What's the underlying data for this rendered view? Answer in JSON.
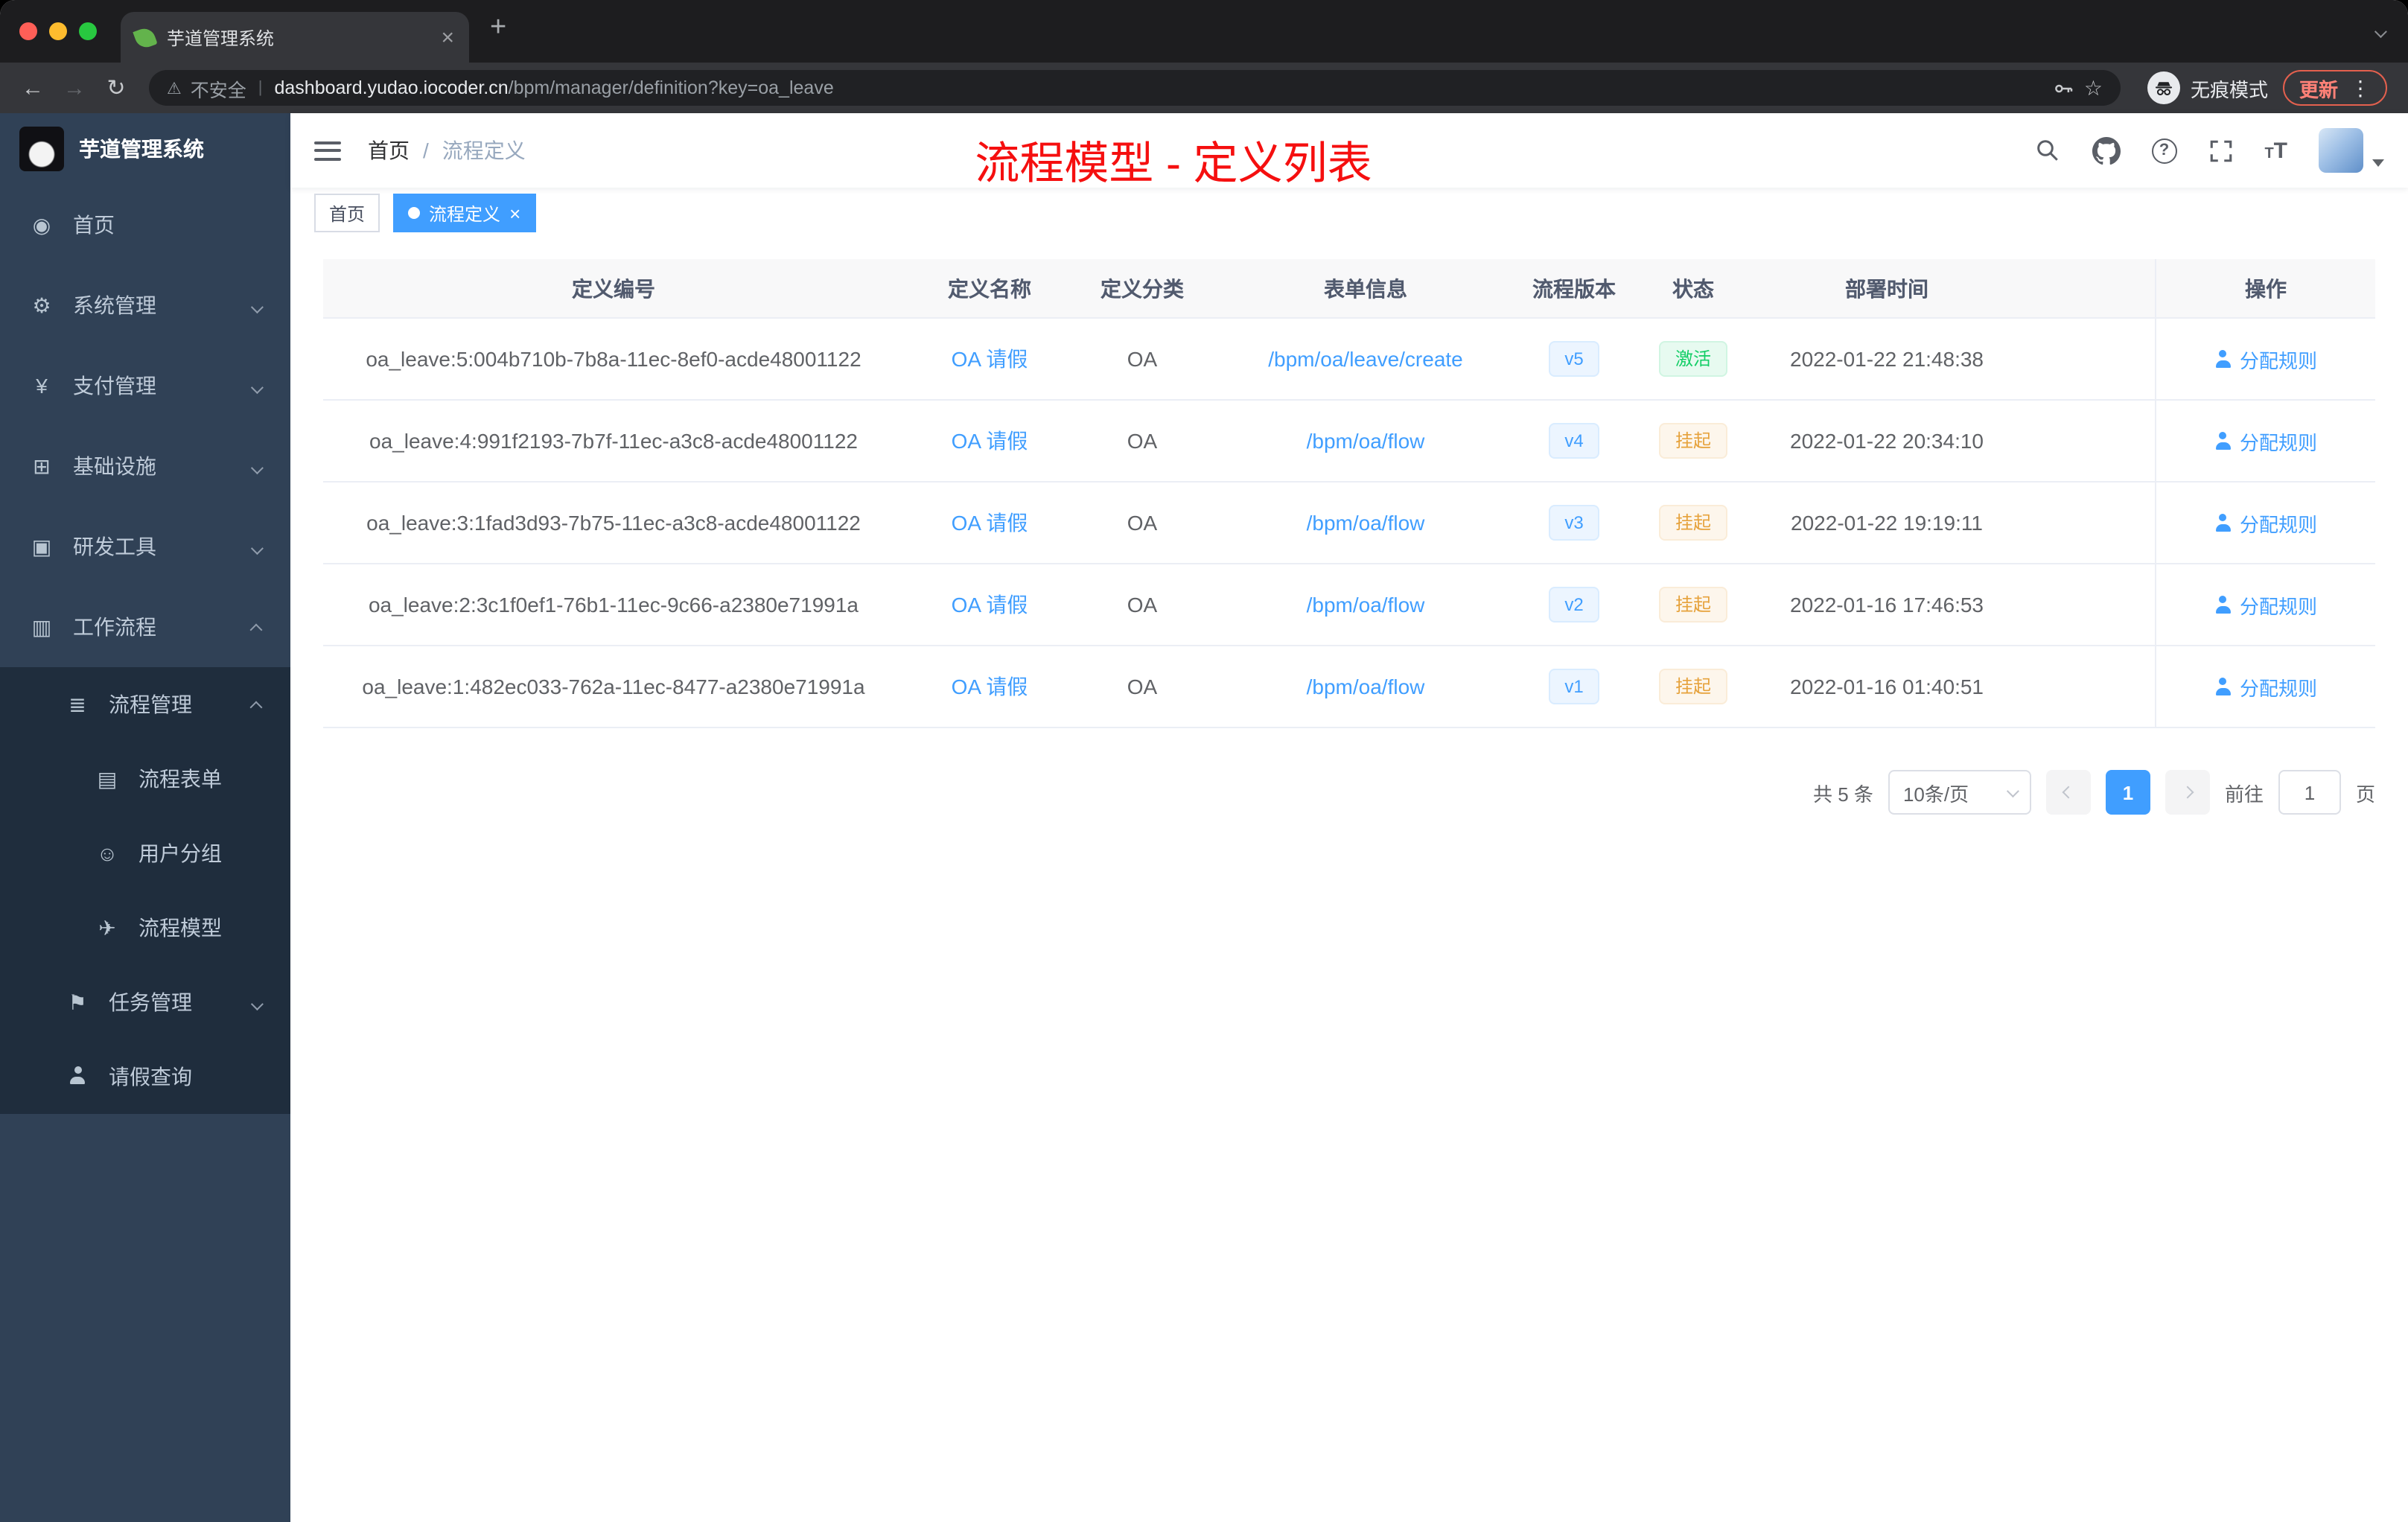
{
  "browser": {
    "tab_title": "芋道管理系统",
    "security_label": "不安全",
    "url_host": "dashboard.yudao.iocoder.cn",
    "url_path": "/bpm/manager/definition?key=oa_leave",
    "incognito_label": "无痕模式",
    "update_button": "更新"
  },
  "sidebar": {
    "logo_title": "芋道管理系统",
    "items": [
      {
        "label": "首页"
      },
      {
        "label": "系统管理"
      },
      {
        "label": "支付管理"
      },
      {
        "label": "基础设施"
      },
      {
        "label": "研发工具"
      },
      {
        "label": "工作流程"
      },
      {
        "label": "流程管理"
      },
      {
        "label": "流程表单"
      },
      {
        "label": "用户分组"
      },
      {
        "label": "流程模型"
      },
      {
        "label": "任务管理"
      },
      {
        "label": "请假查询"
      }
    ]
  },
  "navbar": {
    "breadcrumb_home": "首页",
    "breadcrumb_separator": "/",
    "breadcrumb_current": "流程定义",
    "annotation": "流程模型 - 定义列表"
  },
  "tags": {
    "home": "首页",
    "current": "流程定义"
  },
  "table": {
    "headers": [
      "定义编号",
      "定义名称",
      "定义分类",
      "表单信息",
      "流程版本",
      "状态",
      "部署时间",
      "操作"
    ],
    "rows": [
      {
        "id": "oa_leave:5:004b710b-7b8a-11ec-8ef0-acde48001122",
        "name": "OA 请假",
        "category": "OA",
        "form": "/bpm/oa/leave/create",
        "version": "v5",
        "status": "激活",
        "status_type": "success",
        "deploy_time": "2022-01-22 21:48:38",
        "action": "分配规则"
      },
      {
        "id": "oa_leave:4:991f2193-7b7f-11ec-a3c8-acde48001122",
        "name": "OA 请假",
        "category": "OA",
        "form": "/bpm/oa/flow",
        "version": "v4",
        "status": "挂起",
        "status_type": "warning",
        "deploy_time": "2022-01-22 20:34:10",
        "action": "分配规则"
      },
      {
        "id": "oa_leave:3:1fad3d93-7b75-11ec-a3c8-acde48001122",
        "name": "OA 请假",
        "category": "OA",
        "form": "/bpm/oa/flow",
        "version": "v3",
        "status": "挂起",
        "status_type": "warning",
        "deploy_time": "2022-01-22 19:19:11",
        "action": "分配规则"
      },
      {
        "id": "oa_leave:2:3c1f0ef1-76b1-11ec-9c66-a2380e71991a",
        "name": "OA 请假",
        "category": "OA",
        "form": "/bpm/oa/flow",
        "version": "v2",
        "status": "挂起",
        "status_type": "warning",
        "deploy_time": "2022-01-16 17:46:53",
        "action": "分配规则"
      },
      {
        "id": "oa_leave:1:482ec033-762a-11ec-8477-a2380e71991a",
        "name": "OA 请假",
        "category": "OA",
        "form": "/bpm/oa/flow",
        "version": "v1",
        "status": "挂起",
        "status_type": "warning",
        "deploy_time": "2022-01-16 01:40:51",
        "action": "分配规则"
      }
    ]
  },
  "pagination": {
    "total": "共 5 条",
    "page_size": "10条/页",
    "current_page": "1",
    "goto_label": "前往",
    "goto_value": "1",
    "page_unit": "页"
  },
  "colors": {
    "accent_blue": "#409eff",
    "success_green": "#13ce66",
    "warning_orange": "#e6a23c",
    "annotation_red": "#f50f0f",
    "sidebar_bg": "#304156",
    "submenu_bg": "#1f2d3d"
  }
}
